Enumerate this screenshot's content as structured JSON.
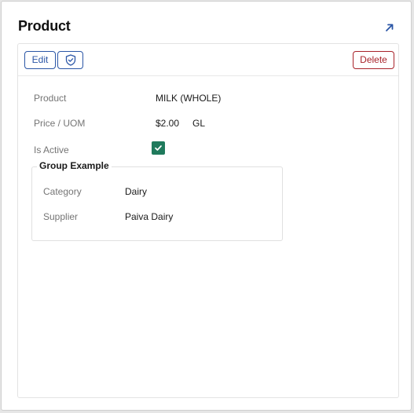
{
  "panel": {
    "title": "Product"
  },
  "toolbar": {
    "edit_label": "Edit",
    "delete_label": "Delete"
  },
  "fields": {
    "product": {
      "label": "Product",
      "value": "MILK (WHOLE)"
    },
    "price": {
      "label": "Price / UOM",
      "value": "$2.00",
      "uom": "GL"
    },
    "is_active": {
      "label": "Is Active",
      "checked": true
    }
  },
  "group": {
    "title": "Group Example",
    "category": {
      "label": "Category",
      "value": "Dairy"
    },
    "supplier": {
      "label": "Supplier",
      "value": "Paiva Dairy"
    }
  },
  "colors": {
    "primary": "#2b56a6",
    "danger": "#a8232a",
    "checkbox": "#1f7a5c"
  },
  "icons": {
    "expand": "arrow-up-right-icon",
    "shield": "shield-check-icon",
    "check": "check-icon"
  }
}
